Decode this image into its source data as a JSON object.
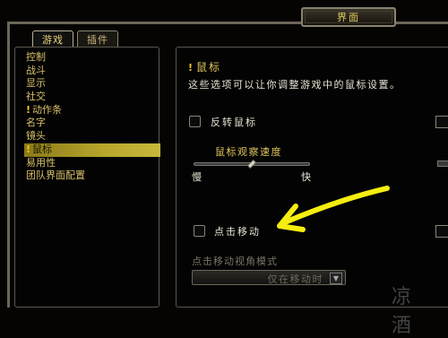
{
  "window": {
    "title": "界面"
  },
  "tabs": [
    {
      "label": "游戏",
      "active": true
    },
    {
      "label": "插件",
      "active": false
    }
  ],
  "categories": [
    {
      "label": "控制"
    },
    {
      "label": "战斗"
    },
    {
      "label": "显示"
    },
    {
      "label": "社交"
    },
    {
      "label": "动作条",
      "warn": true
    },
    {
      "label": "名字"
    },
    {
      "label": "镜头"
    },
    {
      "label": "鼠标",
      "warn": true,
      "selected": true
    },
    {
      "label": "易用性"
    },
    {
      "label": "团队界面配置"
    }
  ],
  "section": {
    "title": "鼠标",
    "description": "这些选项可以让你调整游戏中的鼠标设置。"
  },
  "options": {
    "invert_mouse": {
      "label": "反转鼠标",
      "checked": false
    },
    "look_speed": {
      "label": "鼠标观察速度",
      "min_label": "慢",
      "max_label": "快",
      "value": 0.5
    },
    "click_to_move": {
      "label": "点击移动",
      "checked": false
    },
    "click_move_camera": {
      "label": "点击移动视角模式",
      "value": "仅在移动时"
    }
  },
  "icons": {
    "warning": "!",
    "dropdown_arrow": "▼"
  },
  "colors": {
    "accent": "#e1c65d",
    "selected": "#b8a72c",
    "annotation_arrow": "#f5ee10"
  },
  "watermark": "凉 酒"
}
